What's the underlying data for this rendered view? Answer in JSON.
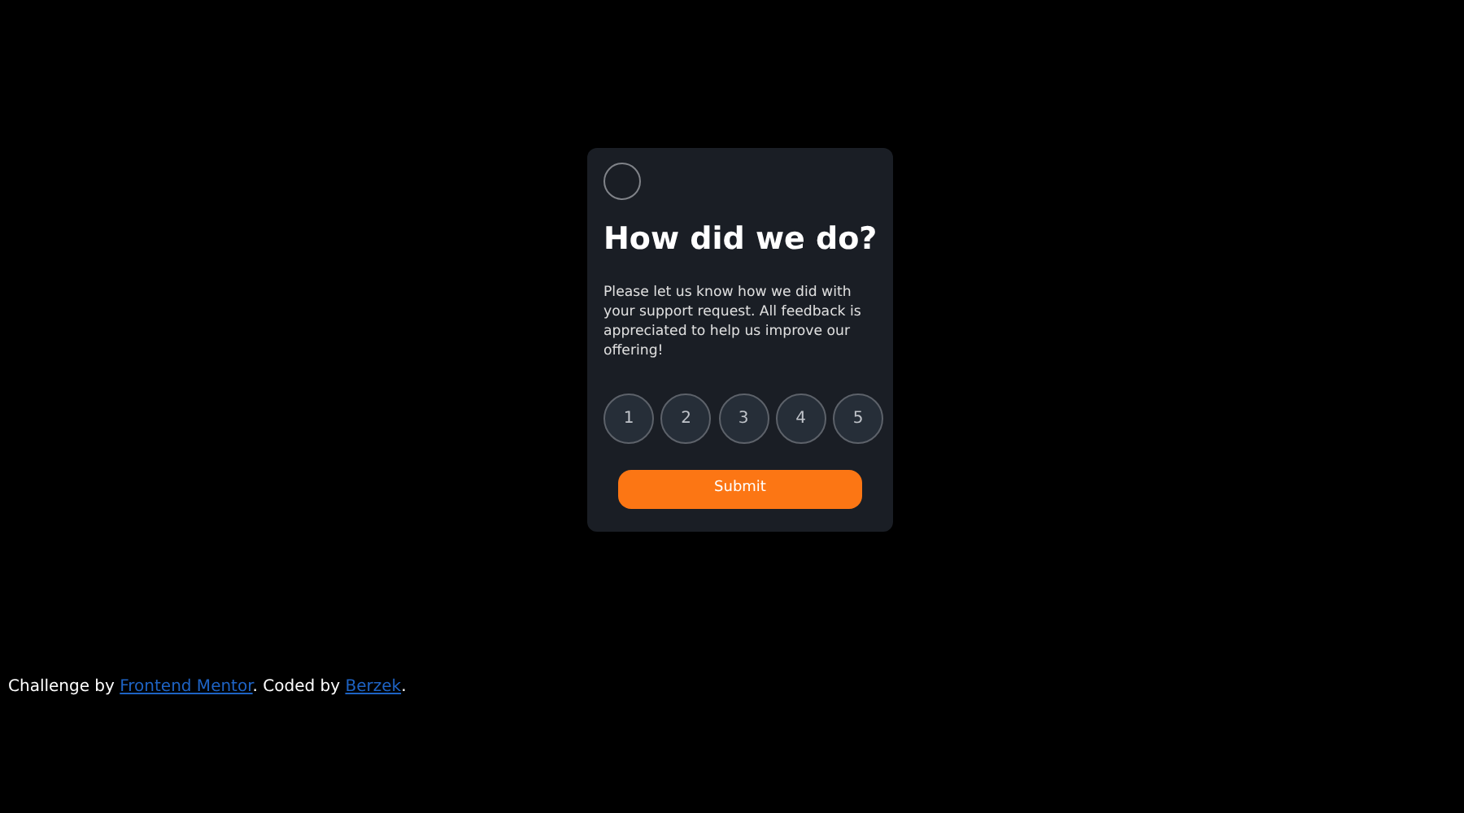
{
  "card": {
    "title": "How did we do?",
    "text": "Please let us know how we did with your support request. All feedback is appreciated to help us improve our offering!",
    "ratings": [
      {
        "label": "1",
        "selected": false
      },
      {
        "label": "2",
        "selected": false
      },
      {
        "label": "3",
        "selected": false
      },
      {
        "label": "4",
        "selected": false
      },
      {
        "label": "5",
        "selected": false
      }
    ],
    "submit": "Submit"
  },
  "attribution": {
    "parts": [
      {
        "kind": "text",
        "text": "Challenge by "
      },
      {
        "kind": "link",
        "text": "Frontend Mentor"
      },
      {
        "kind": "text",
        "text": ". Coded by "
      },
      {
        "kind": "link",
        "text": "Berzek"
      },
      {
        "kind": "text",
        "text": "."
      }
    ]
  }
}
